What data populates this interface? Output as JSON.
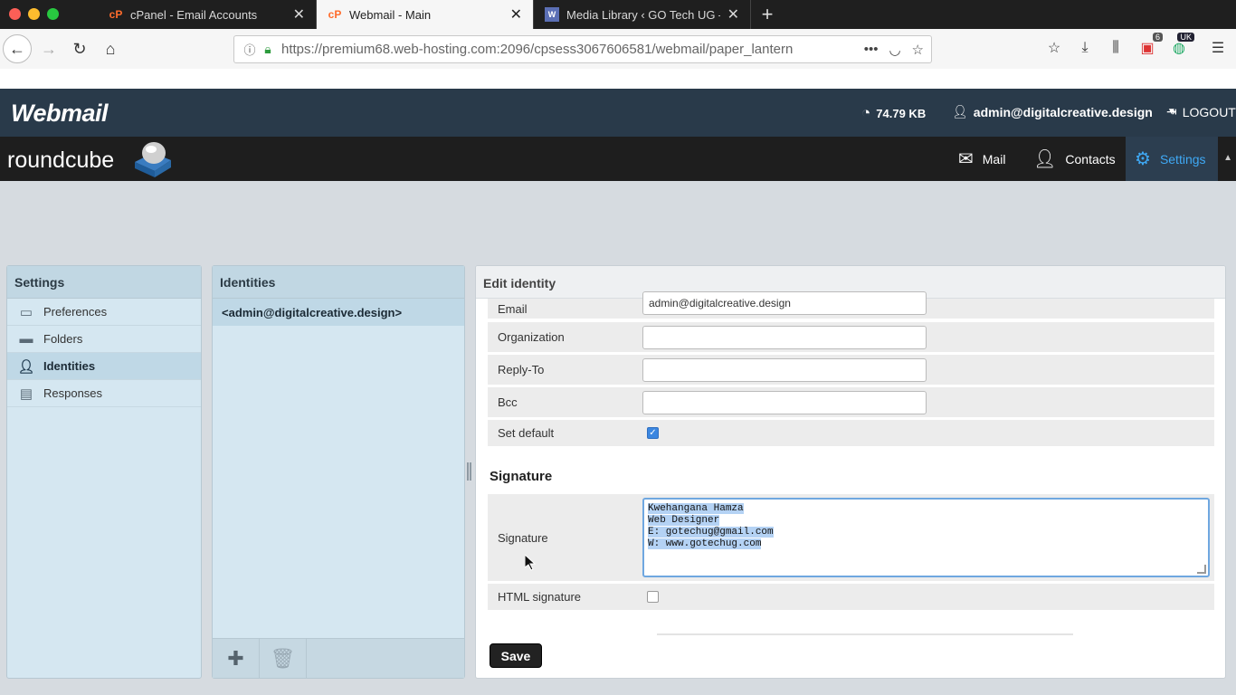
{
  "browser": {
    "tabs": [
      {
        "title": "cPanel - Email Accounts",
        "icon": "cpanel-icon"
      },
      {
        "title": "Webmail - Main",
        "icon": "cpanel-icon"
      },
      {
        "title": "Media Library ‹ GO Tech UG —",
        "icon": "wordpress-icon"
      }
    ],
    "url": "https://premium68.web-hosting.com:2096/cpsess3067606581/webmail/paper_lantern",
    "notification_badge": "6",
    "extension_badge": "UK"
  },
  "header": {
    "logo": "Webmail",
    "quota": "74.79 KB",
    "user": "admin@digitalcreative.design",
    "logout": "LOGOUT"
  },
  "rcbar": {
    "logo": "roundcube",
    "nav": [
      {
        "label": "Mail",
        "icon": "envelope-icon"
      },
      {
        "label": "Contacts",
        "icon": "person-icon"
      },
      {
        "label": "Settings",
        "icon": "gear-icon"
      }
    ]
  },
  "settings_panel": {
    "title": "Settings",
    "items": [
      {
        "label": "Preferences",
        "icon": "monitor-icon"
      },
      {
        "label": "Folders",
        "icon": "folder-icon"
      },
      {
        "label": "Identities",
        "icon": "user-icon"
      },
      {
        "label": "Responses",
        "icon": "document-icon"
      }
    ],
    "selected": "Identities"
  },
  "identities_panel": {
    "title": "Identities",
    "items": [
      "<admin@digitalcreative.design>"
    ]
  },
  "edit_identity": {
    "title": "Edit identity",
    "fields": {
      "email": {
        "label": "Email",
        "value": "admin@digitalcreative.design"
      },
      "organization": {
        "label": "Organization",
        "value": ""
      },
      "reply_to": {
        "label": "Reply-To",
        "value": ""
      },
      "bcc": {
        "label": "Bcc",
        "value": ""
      },
      "set_default": {
        "label": "Set default",
        "checked": true
      }
    },
    "signature_section": "Signature",
    "signature_label": "Signature",
    "signature_lines": [
      "Kwehangana Hamza",
      "Web Designer",
      "E: gotechug@gmail.com",
      "W: www.gotechug.com"
    ],
    "html_signature_label": "HTML signature",
    "html_signature_checked": false,
    "save_label": "Save"
  }
}
